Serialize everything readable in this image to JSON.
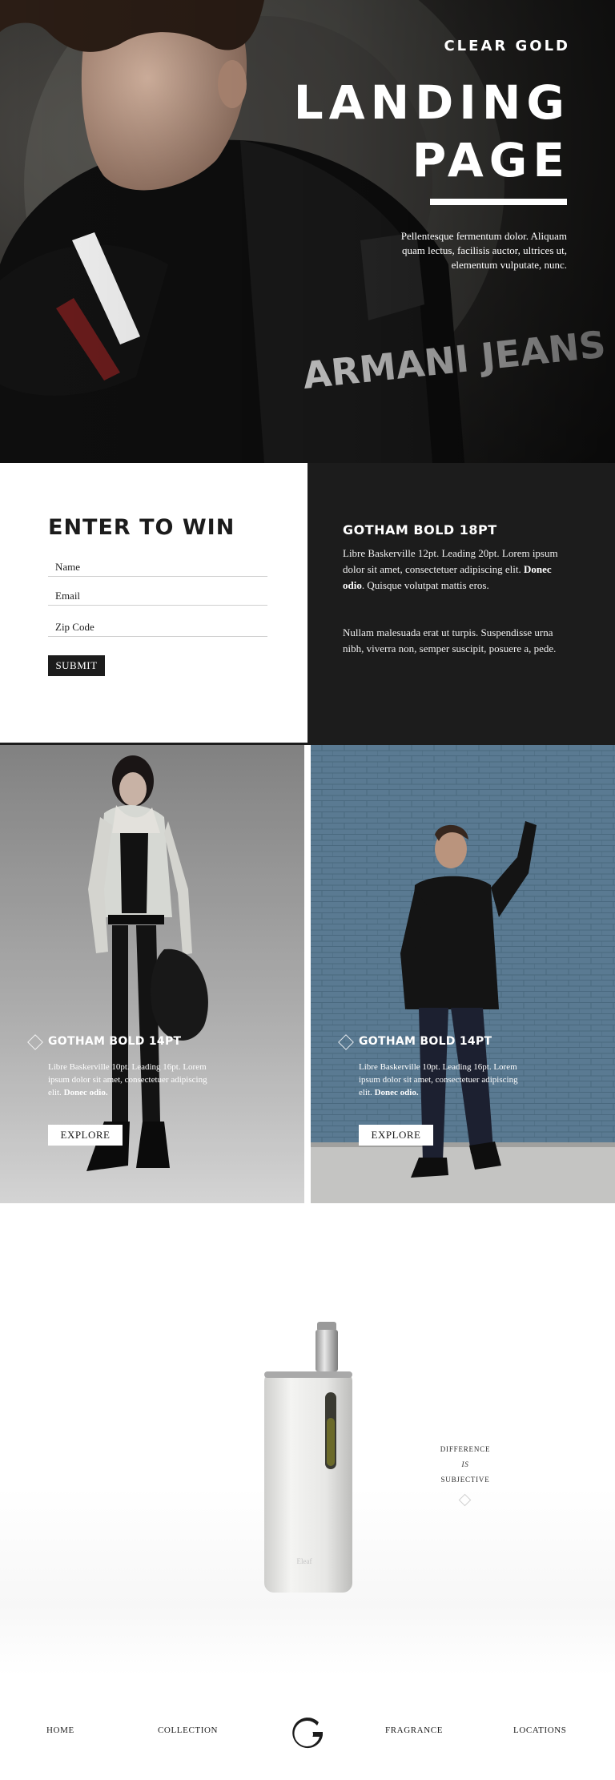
{
  "hero": {
    "brand": "CLEAR GOLD",
    "title_line1": "LANDING",
    "title_line2": "PAGE",
    "text": "Pellentesque fermentum dolor. Aliquam quam lectus, facilisis auctor, ultrices ut, elementum vulputate, nunc.",
    "jacket_print": "ARMANI JEANS"
  },
  "contest": {
    "title": "ENTER TO WIN",
    "fields": [
      {
        "label": "Name"
      },
      {
        "label": "Email"
      },
      {
        "label": "Zip Code"
      }
    ],
    "submit_label": "SUBMIT",
    "info_title": "GOTHAM BOLD 18PT",
    "info_p1_a": "Libre Baskerville 12pt. Leading 20pt. Lorem ipsum dolor sit amet, consectetuer adipiscing elit. ",
    "info_p1_bold": "Donec odio",
    "info_p1_b": ". Quisque volutpat mattis eros.",
    "info_p2": "Nullam malesuada erat ut turpis. Suspendisse urna nibh, viverra non, semper suscipit, posuere a, pede."
  },
  "features": [
    {
      "title": "GOTHAM BOLD 14PT",
      "text_a": "Libre Baskerville 10pt. Leading 16pt. Lorem ipsum dolor sit amet, consectetuer adipiscing elit. ",
      "text_bold": "Donec odio.",
      "button": "EXPLORE"
    },
    {
      "title": "GOTHAM BOLD 14PT",
      "text_a": "Libre Baskerville 10pt. Leading 16pt. Lorem ipsum dolor sit amet, consectetuer adipiscing elit. ",
      "text_bold": "Donec odio.",
      "button": "EXPLORE"
    }
  ],
  "product": {
    "tagline_line1": "DIFFERENCE",
    "tagline_line2": "IS",
    "tagline_line3": "SUBJECTIVE",
    "device_label": "Eleaf"
  },
  "footer": {
    "nav": [
      "HOME",
      "COLLECTION",
      "FRAGRANCE",
      "LOCATIONS"
    ],
    "logo_icon": "g-logo-icon"
  },
  "colors": {
    "dark": "#1c1c1c",
    "white": "#ffffff",
    "brick_blue": "#5d7f99"
  }
}
